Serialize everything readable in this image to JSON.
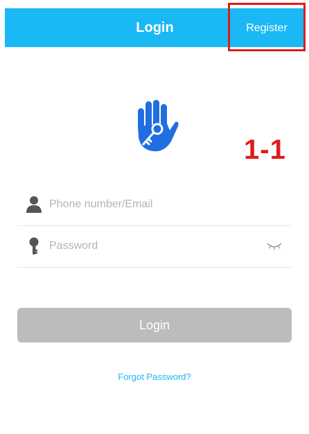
{
  "header": {
    "title": "Login",
    "register_label": "Register"
  },
  "logo": {
    "icon": "hand-key-icon"
  },
  "annotation": {
    "label": "1-1"
  },
  "form": {
    "phone": {
      "icon": "user-icon",
      "value": "",
      "placeholder": "Phone number/Email"
    },
    "password": {
      "icon": "key-icon",
      "value": "",
      "placeholder": "Password",
      "toggle_icon": "eye-closed-icon"
    }
  },
  "actions": {
    "login_label": "Login",
    "forgot_label": "Forgot Password?"
  },
  "colors": {
    "accent": "#1ab8f5",
    "annotation": "#e01b1b",
    "disabled_button": "#bcbcbc",
    "logo_blue": "#1f6fe0"
  }
}
